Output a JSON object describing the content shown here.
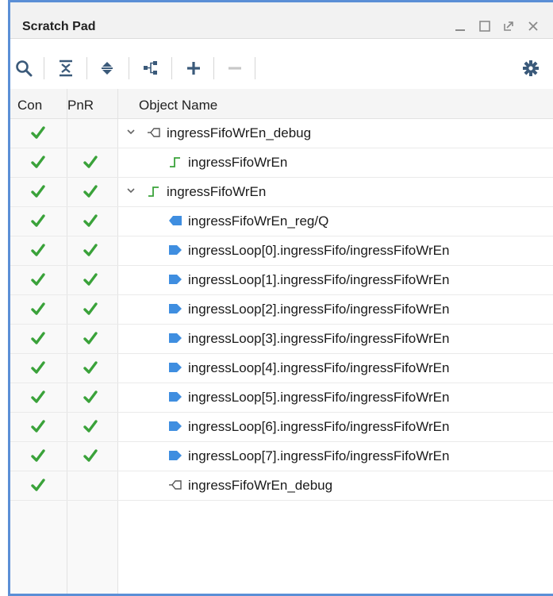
{
  "window": {
    "title": "Scratch Pad",
    "controls": [
      "minimize",
      "restore",
      "float",
      "close"
    ]
  },
  "toolbar": {
    "items": [
      "search-icon",
      "collapse-all-icon",
      "expand-all-icon",
      "hierarchy-icon",
      "add-icon",
      "remove-icon"
    ],
    "settings_icon": "gear-icon"
  },
  "columns": {
    "con": "Con",
    "pnr": "PnR",
    "object": "Object Name"
  },
  "colors": {
    "check": "#3aa23a",
    "port_in": "#3f8ee0",
    "port_out": "#7a7a7a",
    "signal": "#3aa23a",
    "border": "#5b8fd6"
  },
  "rows": [
    {
      "con": true,
      "pnr": false,
      "expander": "collapse",
      "icon": "port-outline-icon",
      "name": "ingressFifoWrEn_debug"
    },
    {
      "con": true,
      "pnr": true,
      "expander": "",
      "icon": "signal-edge-icon",
      "name": "ingressFifoWrEn"
    },
    {
      "con": true,
      "pnr": true,
      "expander": "collapse",
      "icon": "signal-edge-icon",
      "name": "ingressFifoWrEn"
    },
    {
      "con": true,
      "pnr": true,
      "expander": "",
      "icon": "port-in-icon",
      "name": "ingressFifoWrEn_reg/Q"
    },
    {
      "con": true,
      "pnr": true,
      "expander": "",
      "icon": "port-out-icon",
      "name": "ingressLoop[0].ingressFifo/ingressFifoWrEn"
    },
    {
      "con": true,
      "pnr": true,
      "expander": "",
      "icon": "port-out-icon",
      "name": "ingressLoop[1].ingressFifo/ingressFifoWrEn"
    },
    {
      "con": true,
      "pnr": true,
      "expander": "",
      "icon": "port-out-icon",
      "name": "ingressLoop[2].ingressFifo/ingressFifoWrEn"
    },
    {
      "con": true,
      "pnr": true,
      "expander": "",
      "icon": "port-out-icon",
      "name": "ingressLoop[3].ingressFifo/ingressFifoWrEn"
    },
    {
      "con": true,
      "pnr": true,
      "expander": "",
      "icon": "port-out-icon",
      "name": "ingressLoop[4].ingressFifo/ingressFifoWrEn"
    },
    {
      "con": true,
      "pnr": true,
      "expander": "",
      "icon": "port-out-icon",
      "name": "ingressLoop[5].ingressFifo/ingressFifoWrEn"
    },
    {
      "con": true,
      "pnr": true,
      "expander": "",
      "icon": "port-out-icon",
      "name": "ingressLoop[6].ingressFifo/ingressFifoWrEn"
    },
    {
      "con": true,
      "pnr": true,
      "expander": "",
      "icon": "port-out-icon",
      "name": "ingressLoop[7].ingressFifo/ingressFifoWrEn"
    },
    {
      "con": true,
      "pnr": false,
      "expander": "",
      "icon": "port-outline-icon",
      "name": "ingressFifoWrEn_debug"
    }
  ]
}
